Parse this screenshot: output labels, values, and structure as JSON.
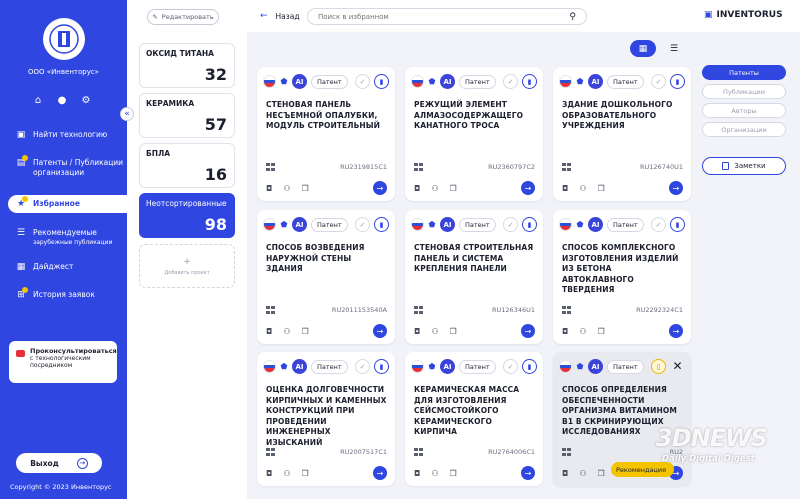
{
  "sidebar": {
    "org_name": "ООО «Инвенторус»",
    "nav": [
      {
        "label": "Найти технологию",
        "sub": ""
      },
      {
        "label": "Патенты / Публикации организации",
        "sub": ""
      },
      {
        "label": "Избранное",
        "sub": ""
      },
      {
        "label": "Рекомендуемые",
        "sub": "зарубежные публикации"
      },
      {
        "label": "Дайджест",
        "sub": ""
      },
      {
        "label": "История заявок",
        "sub": ""
      }
    ],
    "consult_title": "Проконсультироваться",
    "consult_text": "с технологическим посредником",
    "logout": "Выход",
    "copyright": "Copyright  ©  2023 Инвенторус"
  },
  "collections": {
    "edit_label": "Редактировать",
    "items": [
      {
        "name": "ОКСИД ТИТАНА",
        "count": "32"
      },
      {
        "name": "КЕРАМИКА",
        "count": "57"
      },
      {
        "name": "БПЛА",
        "count": "16"
      },
      {
        "name": "Неотсортированные",
        "count": "98"
      }
    ],
    "add_label": "Добавить проект"
  },
  "topbar": {
    "back_label": "Назад",
    "search_placeholder": "Поиск в избранном",
    "brand": "INVENTORUS"
  },
  "filters": {
    "items": [
      "Патенты",
      "Публикации",
      "Авторы",
      "Организации"
    ],
    "notes_label": "Заметки"
  },
  "cards": [
    {
      "type": "Патент",
      "title": "Стеновая панель несъемной опалубки, модуль строительный",
      "number": "RU2319815C1"
    },
    {
      "type": "Патент",
      "title": "Режущий элемент алмазосодержащего канатного троса",
      "number": "RU2360797C2"
    },
    {
      "type": "Патент",
      "title": "Здание дошкольного образовательного учреждения",
      "number": "RU126740U1"
    },
    {
      "type": "Патент",
      "title": "Способ возведения наружной стены здания",
      "number": "RU2011153540A"
    },
    {
      "type": "Патент",
      "title": "Стеновая строительная панель и система крепления панели",
      "number": "RU126346U1"
    },
    {
      "type": "Патент",
      "title": "Способ комплексного изготовления изделий из бетона автоклавного твердения",
      "number": "RU2292324C1"
    },
    {
      "type": "Патент",
      "title": "Оценка долговечности кирпичных и каменных конструкций при проведении инженерных изысканий",
      "number": "RU2007517C1"
    },
    {
      "type": "Патент",
      "title": "Керамическая масса для изготовления сейсмостойкого керамического кирпича",
      "number": "RU2764006C1"
    },
    {
      "type": "Патент",
      "title": "Способ определения обеспеченности организма витамином B1 в скринирующих исследованиях",
      "number": "RU2",
      "badge": "Рекомендация"
    }
  ],
  "watermark": {
    "brand": "3DNEWS",
    "sub": "Daily Digital Digest"
  },
  "colors": {
    "accent": "#2f47e0",
    "highlight": "#f5c400"
  }
}
